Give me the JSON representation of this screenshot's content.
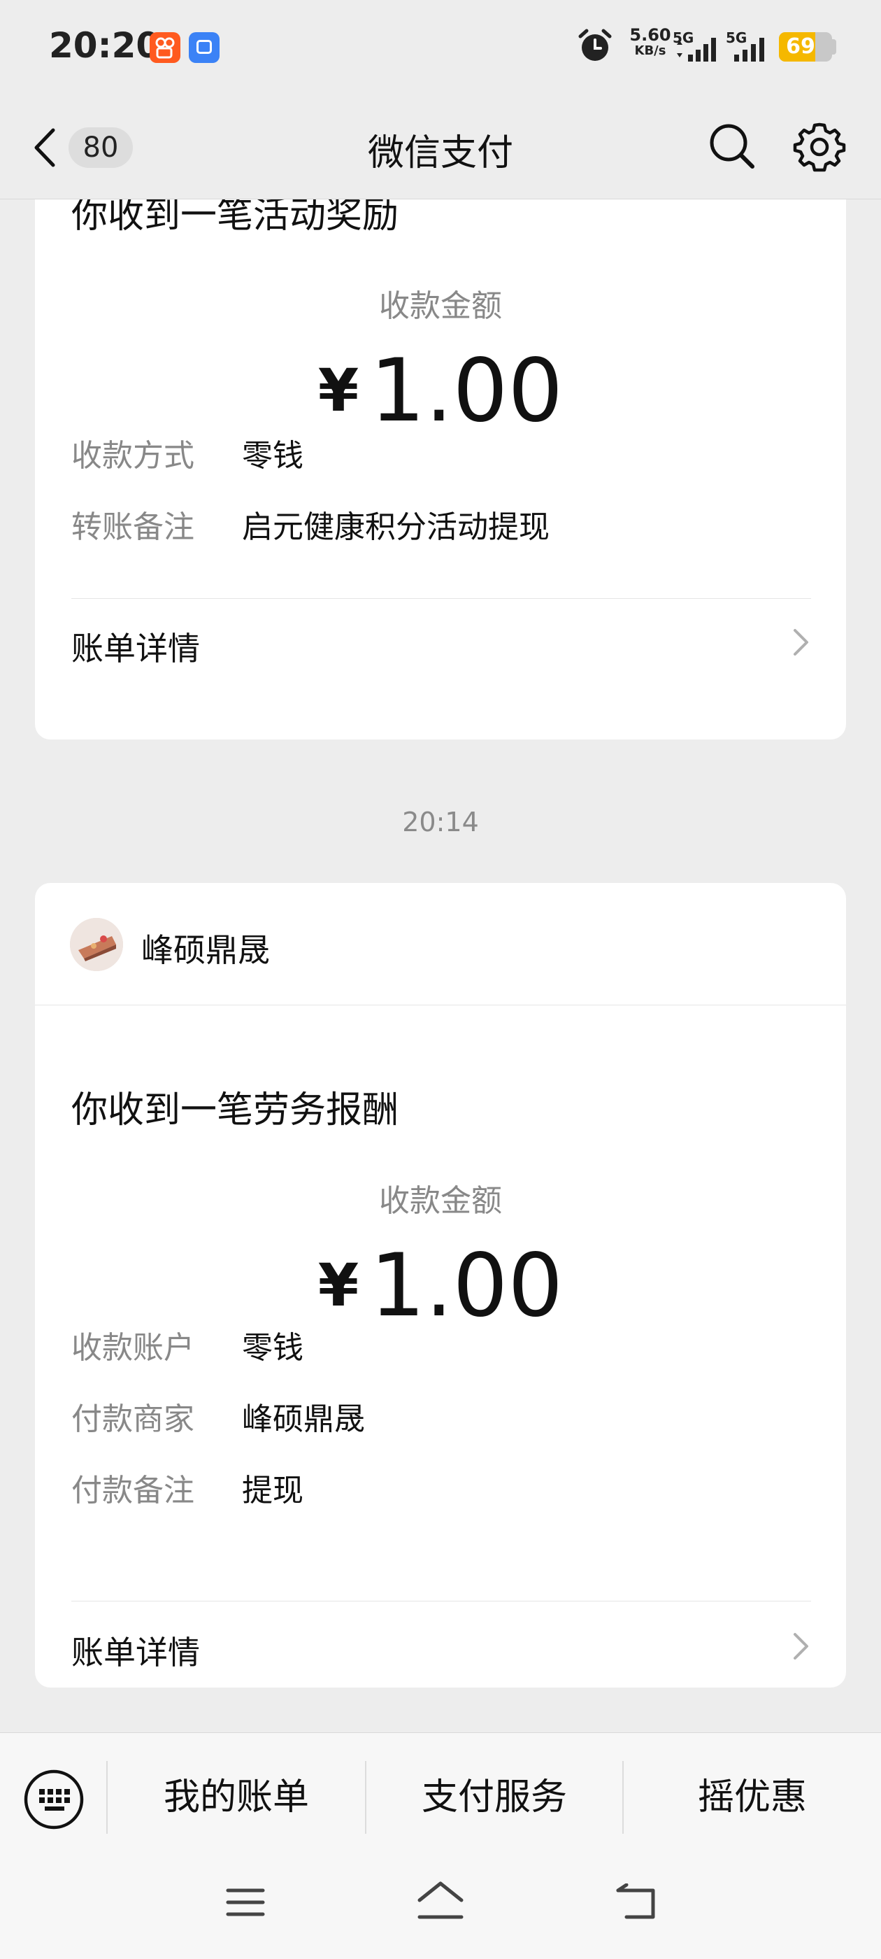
{
  "status_bar": {
    "time": "20:20",
    "net_speed_value": "5.60",
    "net_speed_unit": "KB/s",
    "net_type_1": "5G",
    "net_type_2": "5G",
    "battery_level": "69",
    "battery_fraction": 0.69,
    "icons": [
      "kuaishou-app-icon",
      "message-app-icon",
      "alarm-icon",
      "signal-icon",
      "battery-icon"
    ]
  },
  "nav": {
    "unread_count": "80",
    "title": "微信支付",
    "icons": [
      "back-icon",
      "search-icon",
      "settings-icon"
    ]
  },
  "messages": [
    {
      "heading": "你收到一笔活动奖励",
      "amount_label": "收款金额",
      "currency": "¥",
      "amount": "1.00",
      "rows": [
        {
          "label": "收款方式",
          "value": "零钱"
        },
        {
          "label": "转账备注",
          "value": "启元健康积分活动提现"
        }
      ],
      "detail_link": "账单详情"
    },
    {
      "time": "20:14",
      "merchant": "峰硕鼎晟",
      "heading": "你收到一笔劳务报酬",
      "amount_label": "收款金额",
      "currency": "¥",
      "amount": "1.00",
      "rows": [
        {
          "label": "收款账户",
          "value": "零钱"
        },
        {
          "label": "付款商家",
          "value": "峰硕鼎晟"
        },
        {
          "label": "付款备注",
          "value": "提现"
        }
      ],
      "detail_link": "账单详情"
    }
  ],
  "bottom_menu": {
    "items": [
      "我的账单",
      "支付服务",
      "摇优惠"
    ]
  },
  "colors": {
    "background": "#ededed",
    "card": "#ffffff",
    "battery": "#f5b800",
    "secondary_text": "#888888"
  }
}
